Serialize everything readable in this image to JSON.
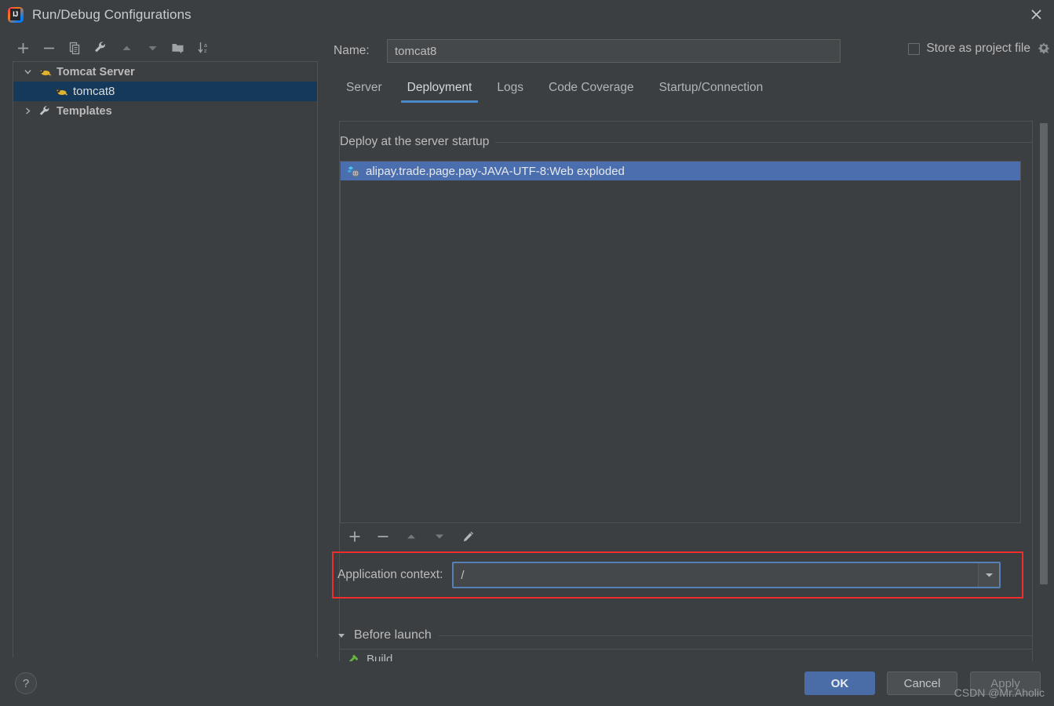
{
  "window": {
    "title": "Run/Debug Configurations",
    "logo_icon": "intellij-idea-logo",
    "close_icon": "close-icon"
  },
  "sidebar": {
    "toolbar": [
      {
        "name": "add",
        "icon": "plus-icon"
      },
      {
        "name": "remove",
        "icon": "minus-icon"
      },
      {
        "name": "copy",
        "icon": "copy-icon"
      },
      {
        "name": "edit-templates",
        "icon": "wrench-icon"
      },
      {
        "name": "move-up",
        "icon": "arrow-up-icon"
      },
      {
        "name": "move-down",
        "icon": "arrow-down-icon"
      },
      {
        "name": "new-folder",
        "icon": "new-folder-icon"
      },
      {
        "name": "sort-alphabetically",
        "icon": "sort-az-icon"
      }
    ],
    "tree": [
      {
        "label": "Tomcat Server",
        "icon": "tomcat-icon",
        "chevron": "chevron-down-icon",
        "level": 1,
        "selected": false
      },
      {
        "label": "tomcat8",
        "icon": "tomcat-icon",
        "chevron": "",
        "level": 2,
        "selected": true
      },
      {
        "label": "Templates",
        "icon": "wrench-icon",
        "chevron": "chevron-right-icon",
        "level": 1,
        "selected": false
      }
    ]
  },
  "name_row": {
    "label": "Name:",
    "value": "tomcat8",
    "placeholder": ""
  },
  "store_as_project_file": {
    "label": "Store as project file",
    "checked": false,
    "gear_icon": "gear-icon"
  },
  "tabs": [
    {
      "label": "Server",
      "active": false
    },
    {
      "label": "Deployment",
      "active": true
    },
    {
      "label": "Logs",
      "active": false
    },
    {
      "label": "Code Coverage",
      "active": false
    },
    {
      "label": "Startup/Connection",
      "active": false
    }
  ],
  "deployment": {
    "group_title": "Deploy at the server startup",
    "items": [
      {
        "label": "alipay.trade.page.pay-JAVA-UTF-8:Web exploded",
        "icon": "artifact-icon",
        "selected": true
      }
    ],
    "toolbar": [
      {
        "name": "add-artifact",
        "icon": "plus-icon"
      },
      {
        "name": "remove-artifact",
        "icon": "minus-icon"
      },
      {
        "name": "move-artifact-up",
        "icon": "arrow-up-icon"
      },
      {
        "name": "move-artifact-down",
        "icon": "arrow-down-icon"
      },
      {
        "name": "edit-artifact",
        "icon": "pencil-icon"
      }
    ]
  },
  "application_context": {
    "label": "Application context:",
    "value": "/",
    "placeholder": "",
    "dropdown_icon": "chevron-down-icon",
    "highlight_color": "#ef2d2d",
    "focus_border_color": "#5781b4"
  },
  "before_launch": {
    "title": "Before launch",
    "collapse_icon": "triangle-down-icon",
    "items": [
      {
        "label": "Build",
        "icon": "build-hammer-icon"
      }
    ]
  },
  "footer": {
    "help_label": "?",
    "ok_label": "OK",
    "cancel_label": "Cancel",
    "apply_label": "Apply"
  },
  "watermark": "CSDN @Mr.Aholic",
  "colors": {
    "background": "#3c3f41",
    "selection_blue": "#4b6eaf",
    "tree_selection": "#15395b",
    "accent_tab": "#4a88c7",
    "primary_button": "#4a6da7",
    "highlight_red": "#ef2d2d"
  }
}
